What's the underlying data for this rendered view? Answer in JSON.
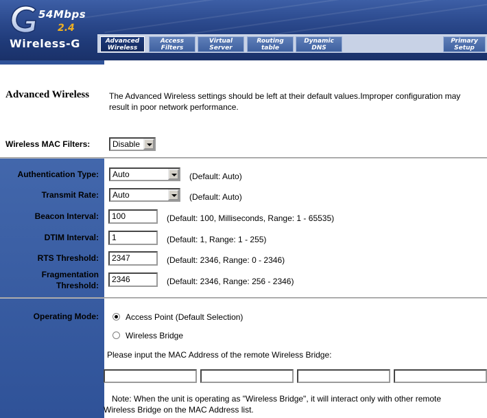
{
  "header": {
    "logo_letter": "G",
    "speed": "54Mbps",
    "frequency": "2.4",
    "product": "Wireless-G"
  },
  "tabs": [
    {
      "label": "Advanced\nWireless",
      "active": true
    },
    {
      "label": "Access\nFilters",
      "active": false
    },
    {
      "label": "Virtual\nServer",
      "active": false
    },
    {
      "label": "Routing\ntable",
      "active": false
    },
    {
      "label": "Dynamic\nDNS",
      "active": false
    },
    {
      "label": "Primary\nSetup",
      "active": false
    }
  ],
  "section": {
    "title": "Advanced Wireless",
    "description": "The Advanced Wireless settings should be left at their default values.Improper configuration may result in poor network performance."
  },
  "mac_filters": {
    "label": "Wireless MAC Filters:",
    "value": "Disable"
  },
  "fields": {
    "auth_type": {
      "label": "Authentication Type:",
      "value": "Auto",
      "hint": "(Default: Auto)"
    },
    "transmit_rate": {
      "label": "Transmit Rate:",
      "value": "Auto",
      "hint": "(Default: Auto)"
    },
    "beacon": {
      "label": "Beacon Interval:",
      "value": "100",
      "hint": "(Default: 100, Milliseconds, Range: 1 - 65535)"
    },
    "dtim": {
      "label": "DTIM Interval:",
      "value": "1",
      "hint": "(Default: 1, Range: 1 - 255)"
    },
    "rts": {
      "label": "RTS Threshold:",
      "value": "2347",
      "hint": "(Default: 2346, Range: 0 - 2346)"
    },
    "frag": {
      "label_line1": "Fragmentation",
      "label_line2": "Threshold:",
      "value": "2346",
      "hint": "(Default: 2346, Range: 256 - 2346)"
    }
  },
  "operating_mode": {
    "label": "Operating Mode:",
    "option_ap": "Access Point (Default Selection)",
    "option_bridge": "Wireless Bridge",
    "selected": "ap",
    "mac_prompt": "Please input the MAC Address of the remote Wireless Bridge:",
    "mac_values": [
      "",
      "",
      "",
      ""
    ],
    "note_line1": "Note: When the unit is operating as \"Wireless Bridge\", it will interact only with other remote",
    "note_line2": "Wireless Bridge on the MAC Address list."
  },
  "colors": {
    "header_blue": "#1f3a78",
    "sidebar_blue": "#3a5ea3",
    "active_tab": "#132a5e"
  }
}
